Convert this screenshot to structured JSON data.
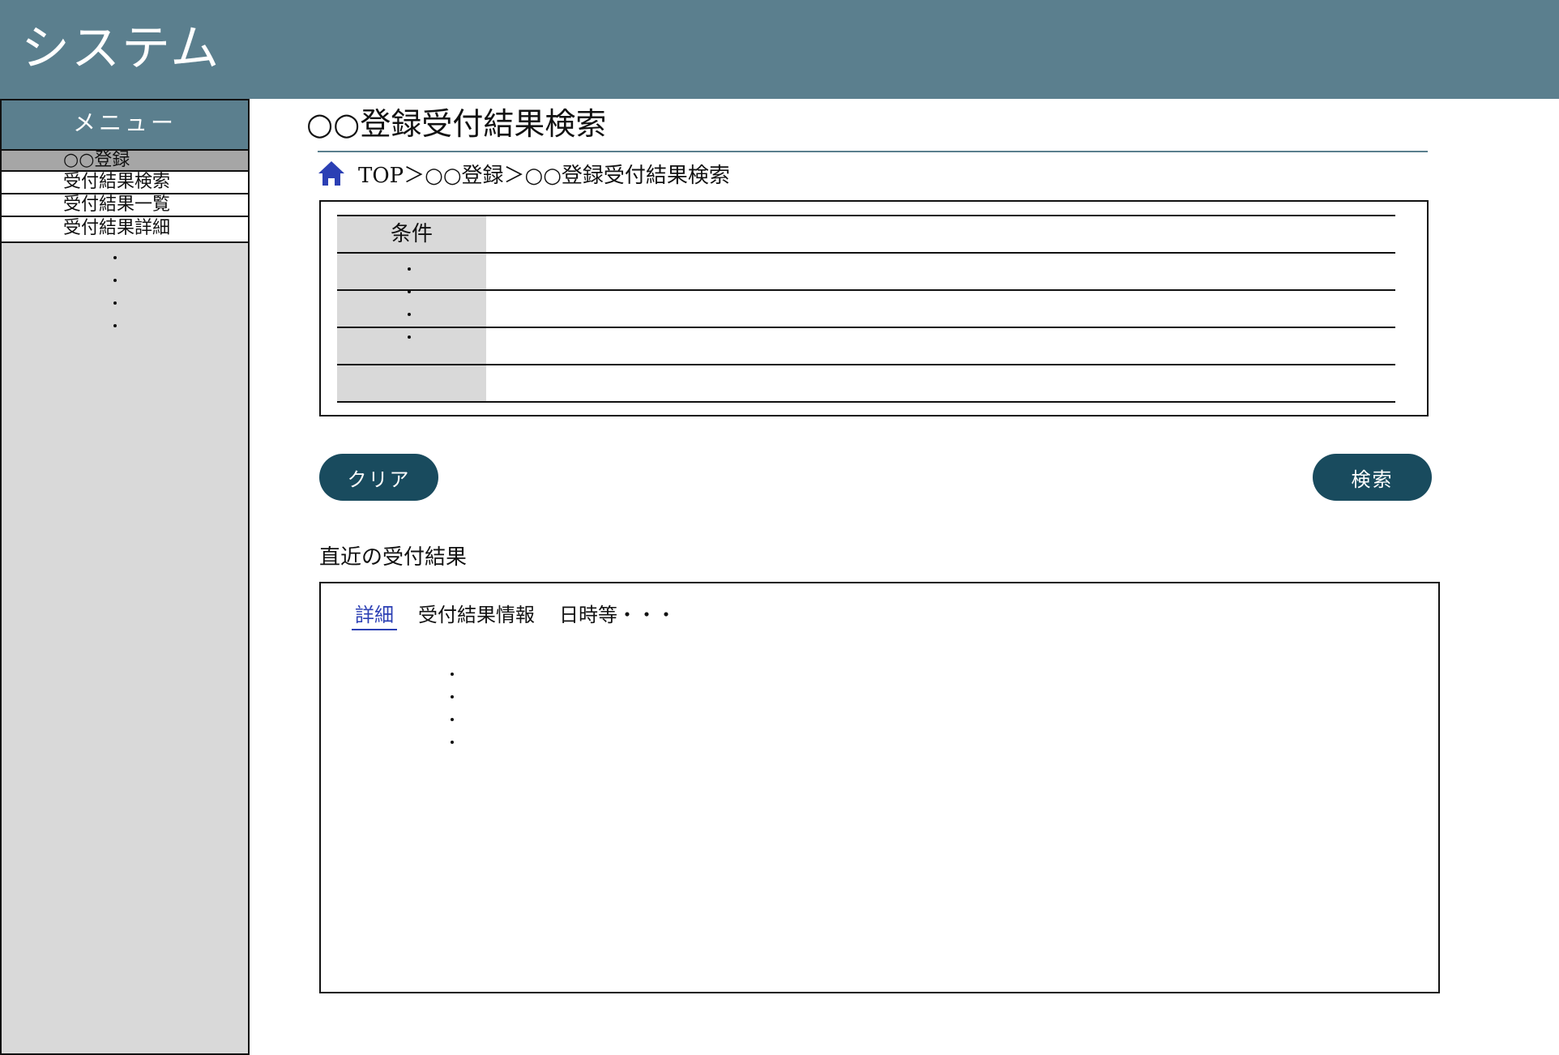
{
  "header": {
    "title": "システム"
  },
  "sidebar": {
    "menu_title": "メニュー",
    "group_label": "○○登録",
    "items": [
      {
        "label": "受付結果検索"
      },
      {
        "label": "受付結果一覧"
      },
      {
        "label": "受付結果詳細"
      }
    ]
  },
  "main": {
    "page_title": "○○登録受付結果検索",
    "breadcrumb": "TOP＞○○登録＞○○登録受付結果検索",
    "conditions": {
      "header_label": "条件"
    },
    "buttons": {
      "clear_label": "クリア",
      "search_label": "検索"
    },
    "recent": {
      "title": "直近の受付結果",
      "tabs": [
        {
          "label": "詳細",
          "active": true
        },
        {
          "label": "受付結果情報"
        },
        {
          "label": "日時等・・・"
        }
      ]
    }
  },
  "colors": {
    "header_bg": "#5b7f8e",
    "button_bg": "#194b5e",
    "sidebar_bg": "#d9d9d9",
    "active_tab": "#2b3fb4",
    "home_icon": "#2b3fb4"
  },
  "icons": {
    "breadcrumb_home": "home-icon"
  }
}
